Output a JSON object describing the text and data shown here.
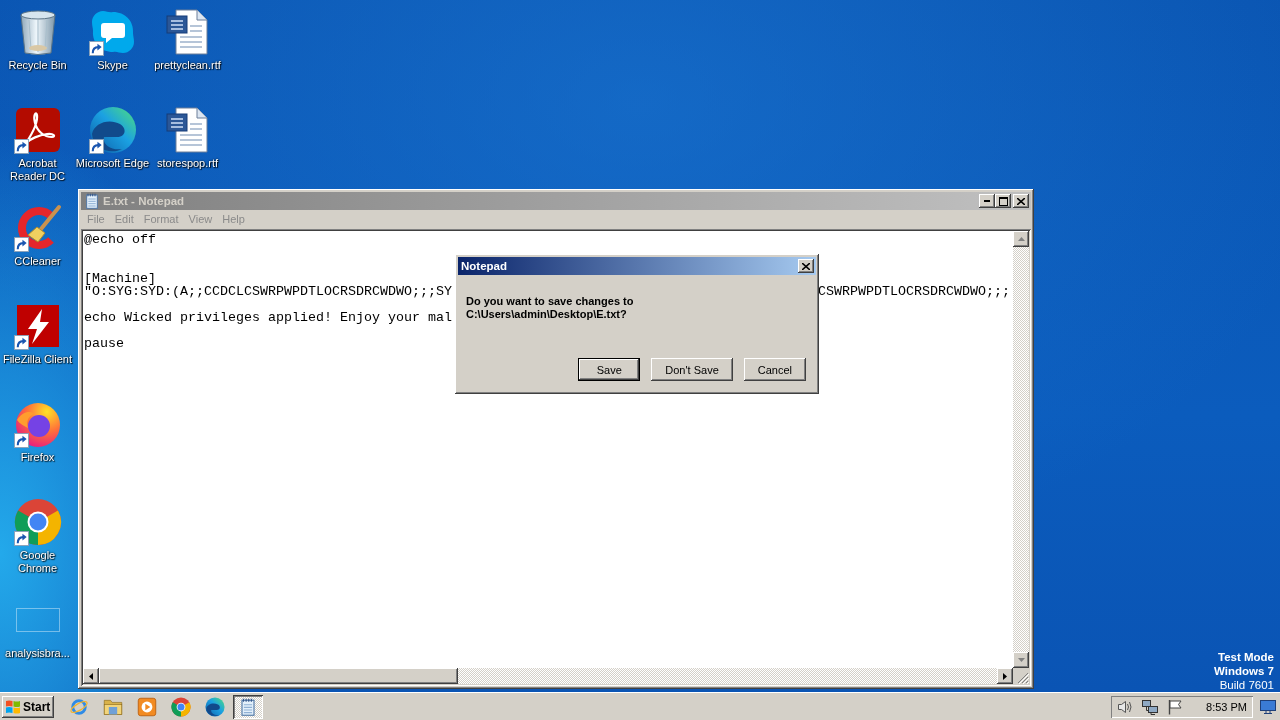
{
  "desktop": {
    "icon_columns": [
      [
        {
          "label": "Recycle Bin",
          "kind": "recycle-bin",
          "shortcut": false
        },
        {
          "label": "Acrobat Reader DC",
          "kind": "pdf-reader",
          "shortcut": true
        },
        {
          "label": "CCleaner",
          "kind": "cleaner",
          "shortcut": true
        },
        {
          "label": "FileZilla Client",
          "kind": "ftp-client",
          "shortcut": true
        },
        {
          "label": "Firefox",
          "kind": "firefox",
          "shortcut": true
        },
        {
          "label": "Google Chrome",
          "kind": "chrome",
          "shortcut": true
        },
        {
          "label": "analysisbra...",
          "kind": "blank",
          "shortcut": false
        }
      ],
      [
        {
          "label": "Skype",
          "kind": "skype",
          "shortcut": true
        },
        {
          "label": "Microsoft Edge",
          "kind": "edge",
          "shortcut": true
        }
      ],
      [
        {
          "label": "prettyclean.rtf",
          "kind": "document",
          "shortcut": false
        },
        {
          "label": "storespop.rtf",
          "kind": "document",
          "shortcut": false
        }
      ]
    ],
    "system_notice": {
      "mode": "Test Mode",
      "os": "Windows 7",
      "build": "Build 7601"
    }
  },
  "notepad": {
    "title": "E.txt - Notepad",
    "active": false,
    "menu": [
      {
        "label": "File",
        "disabled": true
      },
      {
        "label": "Edit",
        "disabled": true
      },
      {
        "label": "Format",
        "disabled": true
      },
      {
        "label": "View",
        "disabled": true
      },
      {
        "label": "Help",
        "disabled": true
      }
    ],
    "lines": [
      {
        "kind": "text",
        "text": "@echo off"
      },
      {
        "kind": "blank"
      },
      {
        "kind": "blank"
      },
      {
        "kind": "text",
        "text": "[Machine]"
      },
      {
        "kind": "split",
        "left": "\"O:SYG:SYD:(A;;CCDCLCSWRPWPDTLOCRSDRCWDWO;;;SY",
        "right": "CSWRPWPDTLOCRSDRCWDWO;;;"
      },
      {
        "kind": "blank"
      },
      {
        "kind": "text",
        "text": "echo Wicked privileges applied! Enjoy your mal"
      },
      {
        "kind": "blank"
      },
      {
        "kind": "text",
        "text": "pause"
      }
    ]
  },
  "dialog": {
    "title": "Notepad",
    "active": true,
    "message": "Do you want to save changes to C:\\Users\\admin\\Desktop\\E.txt?",
    "buttons": [
      {
        "label": "Save",
        "default": true
      },
      {
        "label": "Don't Save",
        "default": false
      },
      {
        "label": "Cancel",
        "default": false
      }
    ]
  },
  "taskbar": {
    "start": {
      "label": "Start"
    },
    "quick_launch": [
      {
        "kind": "ie"
      },
      {
        "kind": "explorer"
      },
      {
        "kind": "media-player"
      },
      {
        "kind": "chrome"
      },
      {
        "kind": "edge"
      }
    ],
    "tasks": [
      {
        "kind": "notepad",
        "selected": true
      }
    ],
    "tray": {
      "icons": [
        {
          "kind": "volume"
        },
        {
          "kind": "network"
        },
        {
          "kind": "flag"
        }
      ],
      "time": "8:53 PM"
    }
  }
}
